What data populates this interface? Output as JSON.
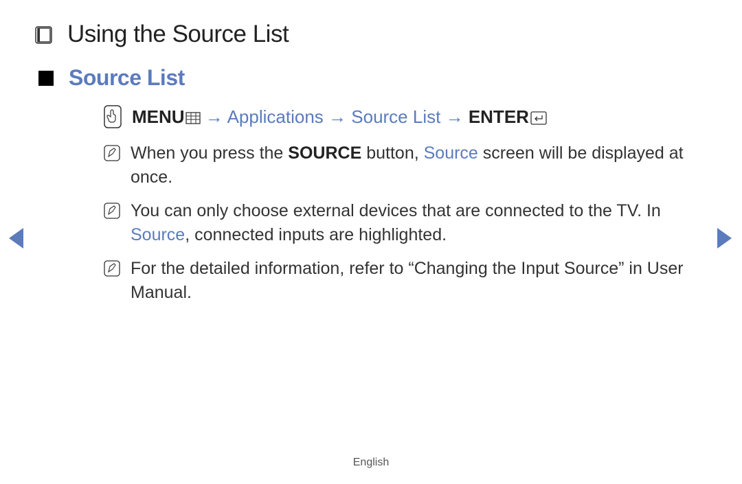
{
  "chapter": {
    "title": "Using the Source List"
  },
  "section": {
    "title": "Source List"
  },
  "nav_path": {
    "menu_label": "MENU",
    "applications": "Applications",
    "source_list": "Source List",
    "enter_label": "ENTER",
    "arrow": "→"
  },
  "notes": [
    {
      "pre": "When you press the ",
      "bold1": "SOURCE",
      "mid1": " button, ",
      "link1": "Source",
      "post": " screen will be displayed at once."
    },
    {
      "pre": "You can only choose external devices that are connected to the TV. In ",
      "link1": "Source",
      "post": ", connected inputs are highlighted."
    },
    {
      "pre": "For the detailed information, refer to “Changing the Input Source” in User Manual.",
      "post": ""
    }
  ],
  "footer": {
    "language": "English"
  }
}
